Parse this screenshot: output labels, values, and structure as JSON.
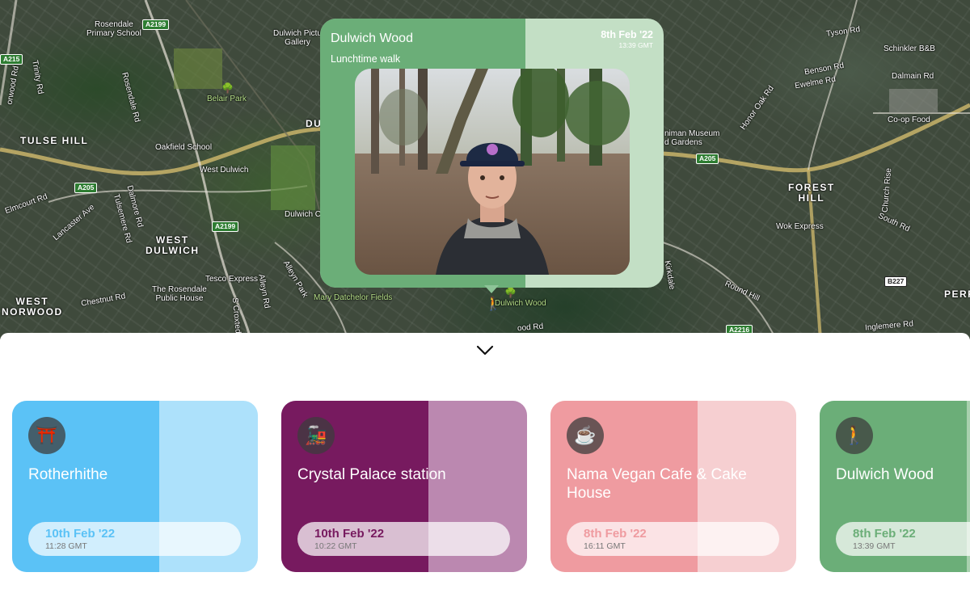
{
  "map": {
    "areas": [
      {
        "id": "tulse-hill",
        "label": "TULSE HILL"
      },
      {
        "id": "west-dulwich",
        "label": "WEST\nDULWICH"
      },
      {
        "id": "west-norwood",
        "label": "WEST\nNORWOOD"
      },
      {
        "id": "forest-hill",
        "label": "FOREST\nHILL"
      },
      {
        "id": "dul",
        "label": "DUL"
      },
      {
        "id": "perr",
        "label": "PERR"
      }
    ],
    "pois": [
      {
        "id": "rosendale-school",
        "label": "Rosendale\nPrimary School"
      },
      {
        "id": "dulwich-gallery",
        "label": "Dulwich Pictu\nGallery"
      },
      {
        "id": "belair-park",
        "label": "Belair Park"
      },
      {
        "id": "oakfield-school",
        "label": "Oakfield School"
      },
      {
        "id": "west-dulwich-station",
        "label": "West Dulwich"
      },
      {
        "id": "dulwich-co",
        "label": "Dulwich Co"
      },
      {
        "id": "tesco",
        "label": "Tesco Express"
      },
      {
        "id": "rosendale-pub",
        "label": "The Rosendale\nPublic House"
      },
      {
        "id": "mary-datchelor",
        "label": "Mary Datchelor Fields"
      },
      {
        "id": "dulwich-wood",
        "label": "Dulwich Wood"
      },
      {
        "id": "horniman",
        "label": "niman Museum\nd Gardens"
      },
      {
        "id": "wok-express",
        "label": "Wok Express"
      },
      {
        "id": "schinkler",
        "label": "Schinkler B&B"
      },
      {
        "id": "coop",
        "label": "Co-op Food"
      },
      {
        "id": "dalmain",
        "label": "Dalmain Rd"
      }
    ],
    "streets": [
      {
        "id": "trinity-rd",
        "label": "Trinity Rd"
      },
      {
        "id": "norwood-rd",
        "label": "orwood Rd"
      },
      {
        "id": "rosendale-rd",
        "label": "Rosendale Rd"
      },
      {
        "id": "elmcourt-rd",
        "label": "Elmcourt Rd"
      },
      {
        "id": "lancaster-ave",
        "label": "Lancaster Ave"
      },
      {
        "id": "tulsemere-rd",
        "label": "Tulsemere Rd"
      },
      {
        "id": "dalmore-rd",
        "label": "Dalmore Rd"
      },
      {
        "id": "chestnut-rd",
        "label": "Chestnut Rd"
      },
      {
        "id": "alleyn-park",
        "label": "Alleyn Park"
      },
      {
        "id": "alleyn-rd",
        "label": "Alleyn Rd"
      },
      {
        "id": "croxted",
        "label": "S Croxted"
      },
      {
        "id": "tyson-rd",
        "label": "Tyson Rd"
      },
      {
        "id": "benson-rd",
        "label": "Benson Rd"
      },
      {
        "id": "ewelme-rd",
        "label": "Ewelme Rd"
      },
      {
        "id": "honor-oak-rd",
        "label": "Honor Oak Rd"
      },
      {
        "id": "round-hill",
        "label": "Round Hill"
      },
      {
        "id": "south-rd",
        "label": "South Rd"
      },
      {
        "id": "church-rise",
        "label": "Church Rise"
      },
      {
        "id": "inglemere-rd",
        "label": "Inglemere Rd"
      },
      {
        "id": "kirkdale",
        "label": "Kirkdale"
      },
      {
        "id": "wood-rd",
        "label": "ood Rd"
      }
    ],
    "road_badges": [
      {
        "id": "a2199-top",
        "label": "A2199"
      },
      {
        "id": "a215",
        "label": "A215"
      },
      {
        "id": "a205-left",
        "label": "A205"
      },
      {
        "id": "a2199-mid",
        "label": "A2199"
      },
      {
        "id": "a205-right",
        "label": "A205"
      },
      {
        "id": "b227",
        "label": "B227"
      },
      {
        "id": "a2216",
        "label": "A2216"
      }
    ]
  },
  "popup": {
    "title": "Dulwich Wood",
    "subtitle": "Lunchtime walk",
    "date": "8th Feb '22",
    "time": "13:39 GMT",
    "tint_color": "#6bae78",
    "bg_color": "#c3dfc5",
    "photo_alt": "selfie in woodland"
  },
  "sheet": {
    "collapse_icon": "chevron-down-icon"
  },
  "cards": [
    {
      "name": "Rotherhithe",
      "emoji": "⛩️",
      "icon": "torii-gate-icon",
      "date": "10th Feb '22",
      "time": "11:28 GMT",
      "tint": "#5bc2f6",
      "bg": "#ade1fb",
      "date_color": "#5bc2f6"
    },
    {
      "name": "Crystal Palace station",
      "emoji": "🚂",
      "icon": "train-icon",
      "date": "10th Feb '22",
      "time": "10:22 GMT",
      "tint": "#771a5f",
      "bg": "#bb88b0",
      "date_color": "#771a5f"
    },
    {
      "name": "Nama Vegan Cafe & Cake House",
      "emoji": "☕",
      "icon": "coffee-icon",
      "date": "8th Feb '22",
      "time": "16:11 GMT",
      "tint": "#ef9ba0",
      "bg": "#f6cfd1",
      "date_color": "#ef9ba0"
    },
    {
      "name": "Dulwich Wood",
      "emoji": "🚶",
      "icon": "walking-person-icon",
      "date": "8th Feb '22",
      "time": "13:39 GMT",
      "tint": "#6bae78",
      "bg": "#a8d1ae",
      "date_color": "#6bae78"
    }
  ]
}
